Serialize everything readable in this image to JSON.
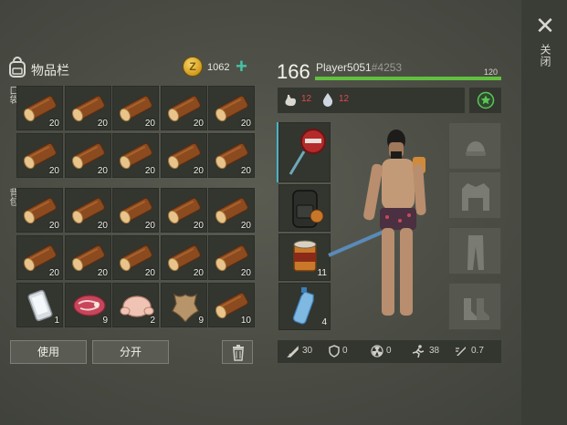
{
  "close": {
    "label": "关闭"
  },
  "inventory": {
    "title": "物品栏",
    "coins": "1062",
    "pocket_label": "口袋",
    "backpack_label": "背包",
    "use_button": "使用",
    "split_button": "分开",
    "pocket_slots": [
      {
        "item": "log",
        "qty": "20"
      },
      {
        "item": "log",
        "qty": "20"
      },
      {
        "item": "log",
        "qty": "20"
      },
      {
        "item": "log",
        "qty": "20"
      },
      {
        "item": "log",
        "qty": "20"
      },
      {
        "item": "log",
        "qty": "20"
      },
      {
        "item": "log",
        "qty": "20"
      },
      {
        "item": "log",
        "qty": "20"
      },
      {
        "item": "log",
        "qty": "20"
      },
      {
        "item": "log",
        "qty": "20"
      }
    ],
    "backpack_slots": [
      {
        "item": "log",
        "qty": "20"
      },
      {
        "item": "log",
        "qty": "20"
      },
      {
        "item": "log",
        "qty": "20"
      },
      {
        "item": "log",
        "qty": "20"
      },
      {
        "item": "log",
        "qty": "20"
      },
      {
        "item": "log",
        "qty": "20"
      },
      {
        "item": "log",
        "qty": "20"
      },
      {
        "item": "log",
        "qty": "20"
      },
      {
        "item": "log",
        "qty": "20"
      },
      {
        "item": "log",
        "qty": "20"
      },
      {
        "item": "phone",
        "qty": "1"
      },
      {
        "item": "raw-meat",
        "qty": "9"
      },
      {
        "item": "raw-chicken",
        "qty": "2"
      },
      {
        "item": "leather",
        "qty": "9"
      },
      {
        "item": "log",
        "qty": "10"
      }
    ]
  },
  "player": {
    "level": "166",
    "name": "Player5051",
    "tag": "#4253",
    "xp_value": "120",
    "xp_fraction": 1.0,
    "hunger": "12",
    "thirst": "12"
  },
  "equipment": {
    "weapon": {
      "icon": "cooking-pan-icon"
    },
    "backpack": {
      "icon": "backpack-icon"
    },
    "food": {
      "icon": "canned-food-icon",
      "qty": "11"
    },
    "drink": {
      "icon": "water-bottle-icon",
      "qty": "4"
    }
  },
  "clothing": [
    "hat-icon",
    "jacket-icon",
    "pants-icon",
    "boots-icon"
  ],
  "stats": {
    "attack": "30",
    "defense": "0",
    "radiation": "0",
    "speed": "38",
    "attack_speed": "0.7"
  },
  "colors": {
    "xp": "#61c13e",
    "accent": "#4ab3c8",
    "coin": "#d19a1c",
    "status": "#e04a4a"
  }
}
